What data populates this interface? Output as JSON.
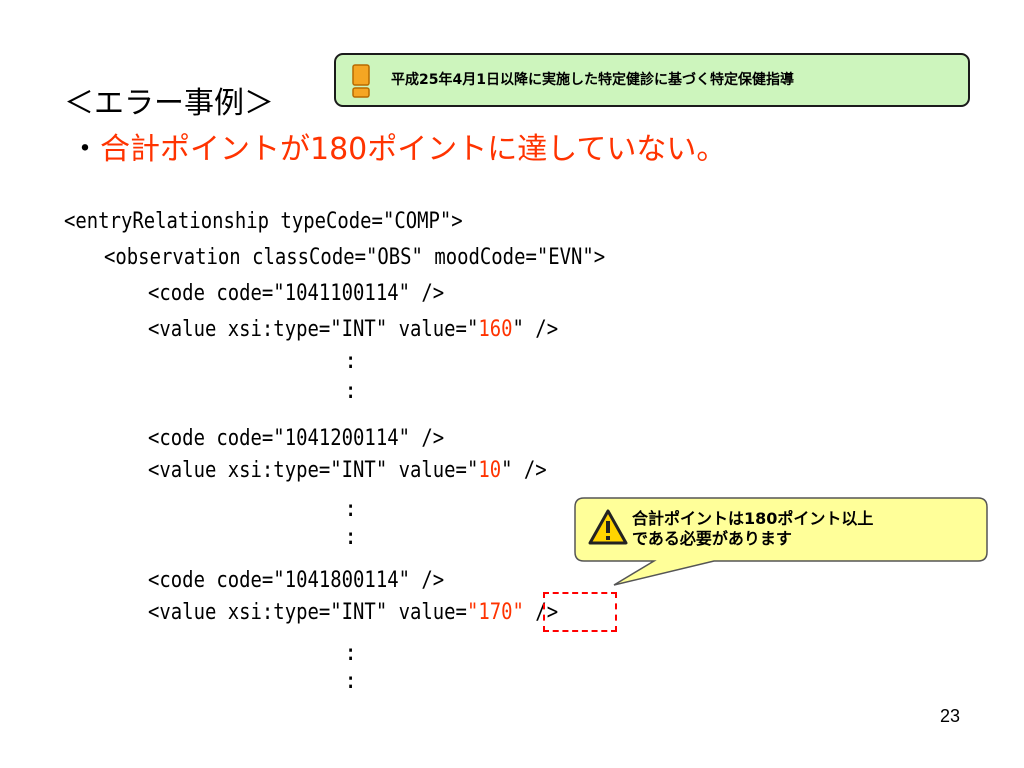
{
  "notice": {
    "text": "平成25年4月1日以降に実施した特定健診に基づく特定保健指導",
    "icon": "exclamation-icon",
    "bg_color": "#cdf5bd"
  },
  "heading": "＜エラー事例＞",
  "subhead": {
    "bullet": "・",
    "text": "合計ポイントが180ポイントに達していない。"
  },
  "code": {
    "line1": "<entryRelationship typeCode=\"COMP\">",
    "line2": "<observation classCode=\"OBS\" moodCode=\"EVN\">",
    "block1": {
      "code_line": "<code code=\"1041100114\" />",
      "value_prefix": "<value xsi:type=\"INT\" value=\"",
      "value": "160",
      "value_suffix": "\" />"
    },
    "block2": {
      "code_line": "<code code=\"1041200114\" />",
      "value_prefix": "<value xsi:type=\"INT\" value=\"",
      "value": "10",
      "value_suffix": "\" />"
    },
    "block3": {
      "code_line": "<code code=\"1041800114\" />",
      "value_prefix": "<value xsi:type=\"INT\" value=",
      "value": "\"170\"",
      "value_suffix": " />"
    },
    "ellipsis": ":"
  },
  "callout": {
    "line1": "合計ポイントは180ポイント以上",
    "line2": "である必要があります",
    "icon": "warning-icon",
    "bg_color": "#ffff99"
  },
  "page_number": "23",
  "accent_color": "#ff3300"
}
